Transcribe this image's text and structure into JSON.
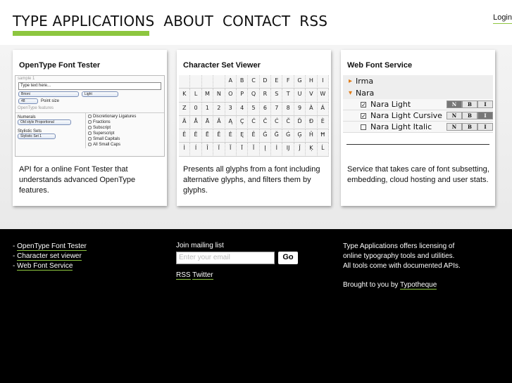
{
  "nav": {
    "items": [
      "TYPE APPLICATIONS",
      "ABOUT",
      "CONTACT",
      "RSS"
    ],
    "login": "Login"
  },
  "colors": {
    "accent": "#8dc63f",
    "orange": "#e07b16",
    "footer_bg": "#000000"
  },
  "cards": [
    {
      "title": "OpenType Font Tester",
      "description": "API for a online Font Tester that understands advanced OpenType features.",
      "mock": {
        "legend": "sample 1",
        "text_value": "Type text here...",
        "font_select": "Brioni",
        "style_select": "Light",
        "size_select": "48",
        "size_label": "Point size",
        "features_legend": "OpenType features",
        "numerals_label": "Numerals",
        "numerals_select": "Old style Proportional",
        "stylistic_label": "Stylistic Sets",
        "stylistic_select": "Stylistic Set 1",
        "options": [
          "Discretionary Ligatures",
          "Fractions",
          "Subscript",
          "Superscript",
          "Small Capitals",
          "All Small Caps"
        ]
      }
    },
    {
      "title": "Character Set Viewer",
      "description": "Presents all glyphs from a font including alternative glyphs, and filters them by glyphs.",
      "glyphs": [
        "",
        "",
        "",
        "",
        "A",
        "B",
        "C",
        "D",
        "E",
        "F",
        "G",
        "H",
        "I",
        "K",
        "L",
        "M",
        "N",
        "O",
        "P",
        "Q",
        "R",
        "S",
        "T",
        "U",
        "V",
        "W",
        "Z",
        "0",
        "1",
        "2",
        "3",
        "4",
        "5",
        "6",
        "7",
        "8",
        "9",
        "À",
        "Á",
        "Ä",
        "Å",
        "Ā",
        "Ă",
        "Ą",
        "Ç",
        "Ć",
        "Ĉ",
        "Ċ",
        "Č",
        "Ď",
        "Đ",
        "È",
        "Ê",
        "Ë",
        "Ē",
        "Ĕ",
        "Ė",
        "Ę",
        "Ě",
        "Ĝ",
        "Ğ",
        "Ġ",
        "Ģ",
        "Ĥ",
        "Ħ",
        "Ì",
        "Í",
        "Î",
        "Ï",
        "Ĩ",
        "Ī",
        "Ĭ",
        "Į",
        "İ",
        "Ĳ",
        "Ĵ",
        "Ķ",
        "Ĺ"
      ]
    },
    {
      "title": "Web Font Service",
      "description": "Service that takes care of font subsetting, embedding, cloud hosting and user stats.",
      "families": [
        {
          "name": "Irma",
          "expanded": false
        },
        {
          "name": "Nara",
          "expanded": true
        }
      ],
      "styles": [
        {
          "name": "Nara Light",
          "checked": true
        },
        {
          "name": "Nara Light Cursive",
          "checked": true
        },
        {
          "name": "Nara Light Italic",
          "checked": false
        }
      ],
      "buttons": [
        "N",
        "B",
        "I"
      ]
    }
  ],
  "footer": {
    "links": [
      "OpenType Font Tester",
      "Character set viewer",
      "Web Font Service"
    ],
    "mailing_label": "Join mailing list",
    "email_placeholder": "Enter your email",
    "go": "Go",
    "rss": "RSS",
    "twitter": "Twitter",
    "about_lines": [
      "Type Applications offers licensing of",
      "online typography tools and utilities.",
      "All tools come with documented APIs."
    ],
    "brought_by": "Brought to you by",
    "brought_link": "Typotheque"
  }
}
